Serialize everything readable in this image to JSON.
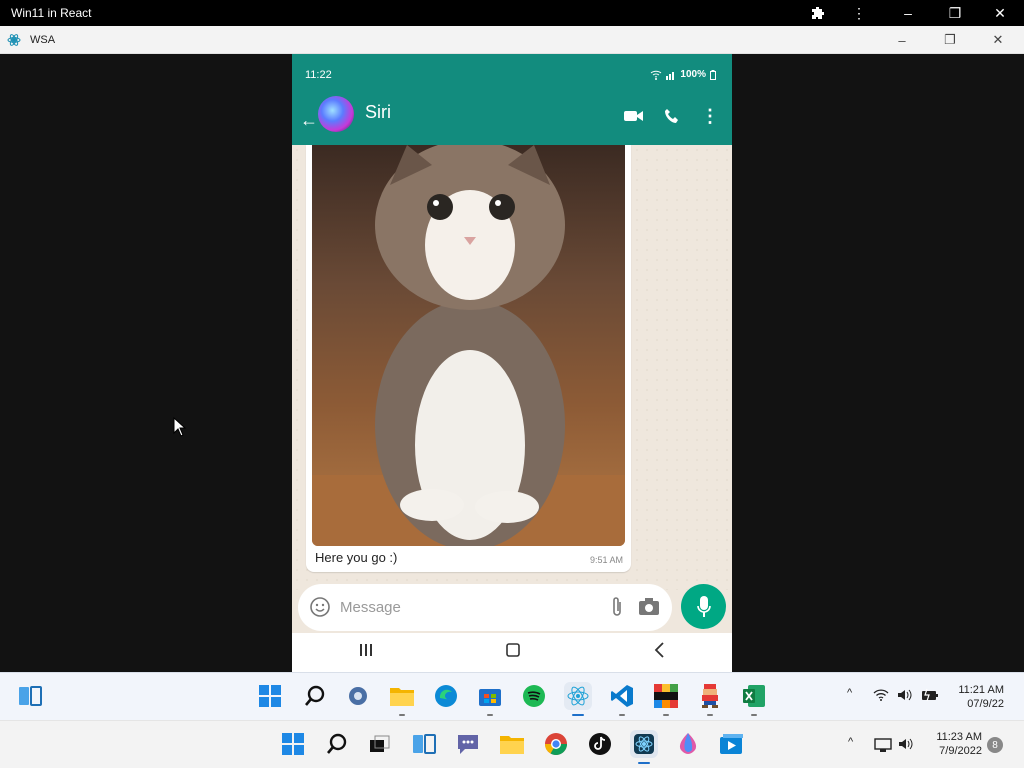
{
  "app": {
    "title": "Win11 in React"
  },
  "wsa": {
    "title": "WSA"
  },
  "phone": {
    "status": {
      "time": "11:22",
      "battery": "100%"
    },
    "header": {
      "contact_name": "Siri"
    },
    "message": {
      "caption": "Here you go :)",
      "time": "9:51 AM"
    },
    "composer": {
      "placeholder": "Message"
    }
  },
  "taskbar_inner": {
    "apps": [
      "start-icon",
      "search-icon",
      "settings-icon",
      "file-explorer-icon",
      "edge-icon",
      "store-icon",
      "spotify-icon",
      "react-icon",
      "vscode-icon",
      "cstimer-icon",
      "mario-icon",
      "excel-icon"
    ],
    "time": "11:21 AM",
    "date": "07/9/22"
  },
  "taskbar_outer": {
    "apps": [
      "start-icon",
      "search-icon",
      "task-view-icon",
      "widgets-icon",
      "teams-chat-icon",
      "file-explorer-icon",
      "chrome-icon",
      "tiktok-icon",
      "wsa-icon",
      "paint-icon",
      "media-player-icon"
    ],
    "time": "11:23 AM",
    "date": "7/9/2022",
    "notifications": "8"
  },
  "colors": {
    "whatsapp_green": "#128c7e",
    "mic_green": "#00a884"
  }
}
